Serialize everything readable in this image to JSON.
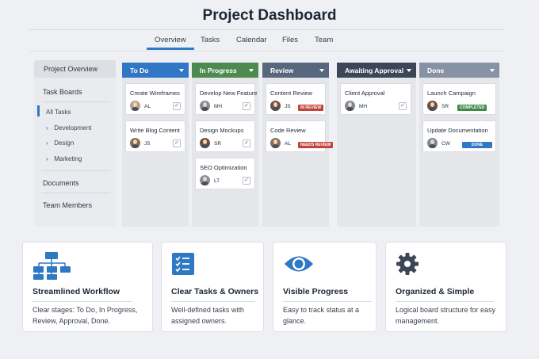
{
  "header": {
    "title": "Project Dashboard"
  },
  "tabs": [
    {
      "label": "Overview",
      "active": true
    },
    {
      "label": "Tasks"
    },
    {
      "label": "Calendar"
    },
    {
      "label": "Files"
    },
    {
      "label": "Team"
    }
  ],
  "sidebar": {
    "heading": "Project Overview",
    "task_boards": "Task Boards",
    "all_tasks": "All Tasks",
    "sub_items": [
      "Development",
      "Design",
      "Marketing"
    ],
    "documents": "Documents",
    "team_members": "Team Members"
  },
  "board": {
    "columns": [
      {
        "title": "To Do",
        "color": "#3177c6",
        "cards": [
          {
            "title": "Create Wireframes",
            "initials": "AL",
            "checked": true
          },
          {
            "title": "Write Blog Content",
            "initials": "JS",
            "checked": true
          }
        ]
      },
      {
        "title": "In Progress",
        "color": "#4d8a4f",
        "cards": [
          {
            "title": "Develop New Feature",
            "initials": "MH",
            "checked": true
          },
          {
            "title": "Design Mockups",
            "initials": "SR",
            "checked": true
          },
          {
            "title": "SEO Optimization",
            "initials": "LT",
            "checked": true
          }
        ]
      },
      {
        "title": "Review",
        "color": "#58677d",
        "cards": [
          {
            "title": "Content Review",
            "initials": "JS",
            "badge": "IN REVIEW",
            "badge_color": "#c2453b"
          },
          {
            "title": "Code Review",
            "initials": "AL",
            "badge": "NEEDS REVIEW",
            "badge_color": "#c2453b"
          }
        ]
      },
      {
        "title": "Awaiting Approval",
        "color": "#3c4656",
        "cards": [
          {
            "title": "Client Approval",
            "initials": "MH",
            "checked": true
          }
        ]
      },
      {
        "title": "Done",
        "color": "#8793a5",
        "cards": [
          {
            "title": "Launch Campaign",
            "initials": "SR",
            "badge": "COMPLETED",
            "badge_color": "#3f8a48"
          },
          {
            "title": "Update Documentation",
            "initials": "CW",
            "badge": "DONE",
            "badge_color": "#2f78c4"
          }
        ]
      }
    ]
  },
  "features": [
    {
      "icon": "workflow-icon",
      "title": "Streamlined Workflow",
      "desc": "Clear stages: To Do, In Progress, Review, Approval, Done."
    },
    {
      "icon": "checklist-icon",
      "title": "Clear Tasks & Owners",
      "desc": "Well-defined tasks with assigned owners."
    },
    {
      "icon": "eye-icon",
      "title": "Visible Progress",
      "desc": "Easy to track status at a glance."
    },
    {
      "icon": "gear-icon",
      "title": "Organized & Simple",
      "desc": "Logical board structure for easy management."
    }
  ],
  "colors": {
    "accent": "#2f78c4",
    "icon_blue": "#2f78c4",
    "gear": "#3c4656"
  }
}
